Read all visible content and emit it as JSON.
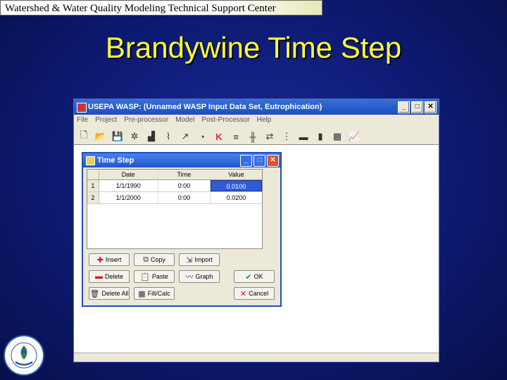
{
  "banner": "Watershed & Water Quality Modeling Technical Support Center",
  "slide_title": "Brandywine Time Step",
  "main_window": {
    "title": "USEPA WASP: (Unnamed WASP Input Data Set, Eutrophication)",
    "menu": [
      "File",
      "Project",
      "Pre-processor",
      "Model",
      "Post-Processor",
      "Help"
    ],
    "toolbar_icons": [
      "new-icon",
      "open-icon",
      "save-icon",
      "tool-icon",
      "chart-icon",
      "graph-icon",
      "run-icon",
      "kinetics-icon",
      "k-icon",
      "flow-icon",
      "segments-icon",
      "exchange-icon",
      "loads-icon",
      "boundary-icon",
      "output-icon",
      "table-icon",
      "plot-icon"
    ]
  },
  "dialog": {
    "title": "Time Step",
    "columns": [
      "",
      "Date",
      "Time",
      "Value"
    ],
    "rows": [
      {
        "n": "1",
        "date": "1/1/1990",
        "time": "0:00",
        "value": "0.0100"
      },
      {
        "n": "2",
        "date": "1/1/2000",
        "time": "0:00",
        "value": "0.0200"
      }
    ],
    "buttons": {
      "insert": "Insert",
      "copy": "Copy",
      "import": "Import",
      "delete": "Delete",
      "paste": "Paste",
      "graph": "Graph",
      "ok": "OK",
      "delete_all": "Delete All",
      "fill_calc": "Fill/Calc",
      "cancel": "Cancel"
    }
  },
  "logo_text": "UNITED STATES ENVIRONMENTAL PROTECTION AGENCY",
  "colors": {
    "title": "#ffff33",
    "background": "#0d1a72"
  }
}
